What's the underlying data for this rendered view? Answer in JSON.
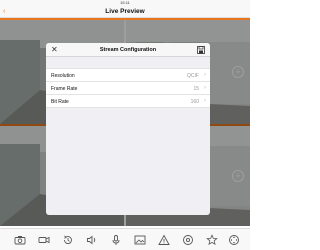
{
  "status_bar": {
    "time": "15:11"
  },
  "header": {
    "title": "Live Preview",
    "back_icon": "chevron-left-icon"
  },
  "modal": {
    "title": "Stream Configuration",
    "close_icon": "close-icon",
    "save_icon": "save-icon",
    "rows": [
      {
        "label": "Resolution",
        "value": "QCIF"
      },
      {
        "label": "Frame Rate",
        "value": "15"
      },
      {
        "label": "Bit Rate",
        "value": "160"
      }
    ]
  },
  "toolbar": {
    "icons": [
      "camera-icon",
      "video-record-icon",
      "playback-icon",
      "volume-icon",
      "microphone-icon",
      "image-icon",
      "alert-icon",
      "stream-settings-icon",
      "favorite-star-icon",
      "ptz-icon"
    ]
  },
  "colors": {
    "accent": "#e8761e",
    "overlay": "rgba(0,0,0,0.38)"
  }
}
